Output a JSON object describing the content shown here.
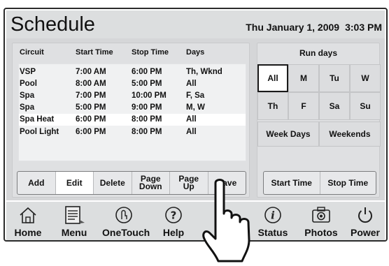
{
  "header": {
    "title": "Schedule",
    "date": "Thu January 1, 2009",
    "time": "3:03 PM"
  },
  "schedule_table": {
    "columns": [
      "Circuit",
      "Start Time",
      "Stop Time",
      "Days"
    ],
    "rows": [
      {
        "circuit": "VSP",
        "start": "7:00 AM",
        "stop": "6:00 PM",
        "days": "Th, Wknd"
      },
      {
        "circuit": "Pool",
        "start": "8:00 AM",
        "stop": "5:00 PM",
        "days": "All"
      },
      {
        "circuit": "Spa",
        "start": "7:00 PM",
        "stop": "10:00 PM",
        "days": "F, Sa"
      },
      {
        "circuit": "Spa",
        "start": "5:00 PM",
        "stop": "9:00 PM",
        "days": "M, W"
      },
      {
        "circuit": "Spa Heat",
        "start": "6:00 PM",
        "stop": "8:00 PM",
        "days": "All"
      },
      {
        "circuit": "Pool Light",
        "start": "6:00 PM",
        "stop": "8:00 PM",
        "days": "All"
      }
    ],
    "selected_row_index": 4
  },
  "buttons": {
    "add": "Add",
    "edit": "Edit",
    "delete": "Delete",
    "page_down_1": "Page",
    "page_down_2": "Down",
    "page_up_1": "Page",
    "page_up_2": "Up",
    "save": "Save"
  },
  "run_days": {
    "title": "Run days",
    "days": [
      "All",
      "M",
      "Tu",
      "W",
      "Th",
      "F",
      "Sa",
      "Su"
    ],
    "selected": "All",
    "week_days": "Week Days",
    "weekends": "Weekends",
    "start_time": "Start Time",
    "stop_time": "Stop Time"
  },
  "nav": {
    "home": "Home",
    "menu": "Menu",
    "onetouch": "OneTouch",
    "help": "Help",
    "status": "Status",
    "photos": "Photos",
    "power": "Power",
    "icons": [
      "house-icon",
      "notepad-icon",
      "onetouch-icon",
      "question-icon",
      "info-icon",
      "camera-icon",
      "power-icon"
    ]
  }
}
